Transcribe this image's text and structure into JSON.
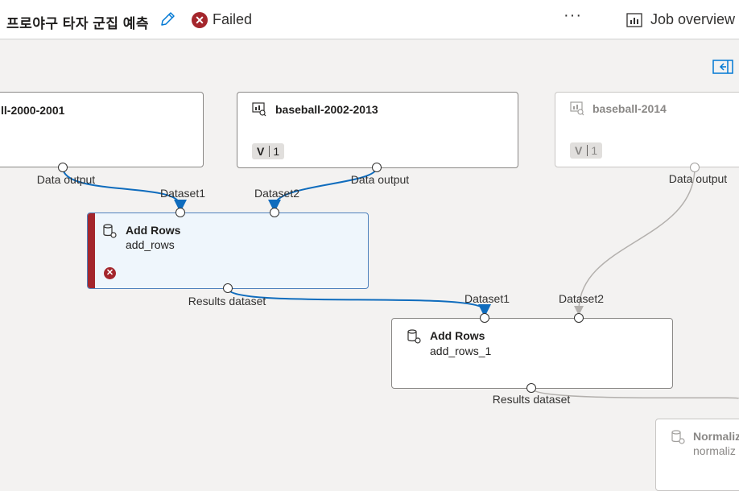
{
  "header": {
    "title": "프로야구 타자 군집 예측",
    "status": "Failed",
    "more": "···",
    "job_overview": "Job overview"
  },
  "nodes": {
    "n2000": {
      "title": "ll-2000-2001",
      "port_out": "Data output"
    },
    "n2002": {
      "title": "baseball-2002-2013",
      "version_label": "V",
      "version": "1",
      "port_out": "Data output"
    },
    "n2014": {
      "title": "baseball-2014",
      "version_label": "V",
      "version": "1",
      "port_out": "Data output"
    },
    "addrows": {
      "title": "Add Rows",
      "subtitle": "add_rows",
      "port_in1": "Dataset1",
      "port_in2": "Dataset2",
      "port_out": "Results dataset"
    },
    "addrows1": {
      "title": "Add Rows",
      "subtitle": "add_rows_1",
      "port_in1": "Dataset1",
      "port_in2": "Dataset2",
      "port_out": "Results dataset"
    },
    "normalize": {
      "title": "Normaliz",
      "subtitle": "normaliz"
    }
  },
  "colors": {
    "failed": "#a4262c",
    "edge_active": "#0f6cbd",
    "edge_faded": "#b3b0ad",
    "accent": "#0078d4"
  }
}
